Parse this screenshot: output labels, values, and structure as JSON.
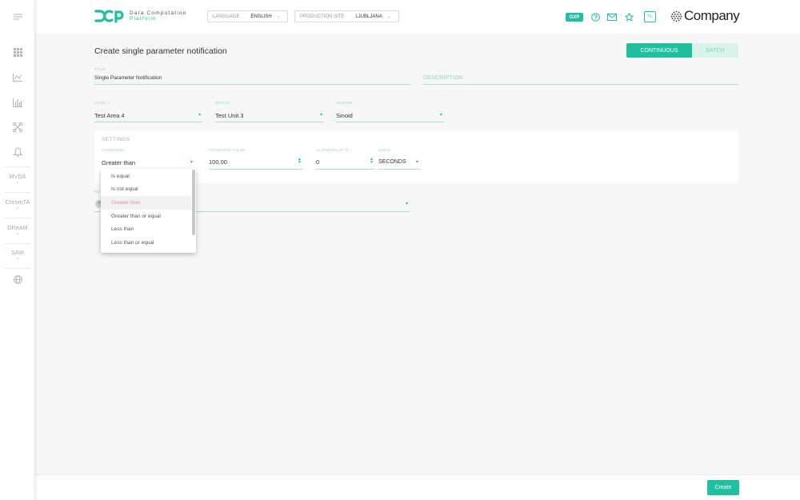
{
  "sidebar": {
    "texts": [
      {
        "label": "MVDA"
      },
      {
        "label": "ChromTA"
      },
      {
        "label": "DReAM"
      },
      {
        "label": "SAW"
      }
    ]
  },
  "header": {
    "logo_line1": "Data Computation",
    "logo_line2": "Platform",
    "language_label": "LANGUAGE",
    "language_value": "ENGLISH",
    "site_label": "PRODUCTION SITE",
    "site_value": "LJUBLJANA",
    "gxp": "GXP",
    "avatar": "TL",
    "company": "Company"
  },
  "page": {
    "title": "Create single parameter notification",
    "mode_continuous": "CONTINUOUS",
    "mode_batch": "BATCH"
  },
  "form": {
    "title_label": "TITLE",
    "title_value": "Single Parameter Notification",
    "description_placeholder": "DESCRIPTION",
    "level_label": "LEVEL 1",
    "level_value": "Test Area 4",
    "device_label": "DEVICE",
    "device_value": "Test Unit 3",
    "sensor_label": "SENSOR",
    "sensor_value": "Sinoid"
  },
  "settings": {
    "title": "SETTINGS",
    "condition_label": "CONDITION",
    "condition_value": "Greater than",
    "condition_value_label": "CONDITION VALUE",
    "condition_value_value": "100.00",
    "alarm_delay_label": "ALARM DELAY TI...",
    "alarm_delay_value": "0",
    "units_label": "UNITS",
    "units_value": "SECONDS"
  },
  "recipients": {
    "label": "NO",
    "chip": "T"
  },
  "dropdown": {
    "options": [
      {
        "label": "Is equal"
      },
      {
        "label": "Is not equal"
      },
      {
        "label": "Greater than"
      },
      {
        "label": "Greater than or equal"
      },
      {
        "label": "Less than"
      },
      {
        "label": "Less than or equal"
      }
    ],
    "selected_index": 2
  },
  "footer": {
    "create_label": "Create"
  },
  "colors": {
    "accent": "#1fbf9f",
    "selected_option": "#e88aa5"
  }
}
